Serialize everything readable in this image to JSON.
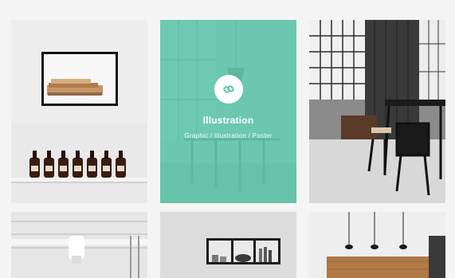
{
  "portfolio": {
    "items": [
      {
        "icon": "framed-art-shelf-photo"
      },
      {
        "title": "Illustration",
        "categories": "Graphic / Illustration / Poster",
        "icon": "link-icon",
        "overlay_color": "#5fc6aa"
      },
      {
        "icon": "loft-dining-photo"
      },
      {
        "icon": "white-ceiling-photo"
      },
      {
        "icon": "wall-shelf-photo"
      },
      {
        "icon": "pendant-lamps-photo"
      }
    ]
  }
}
